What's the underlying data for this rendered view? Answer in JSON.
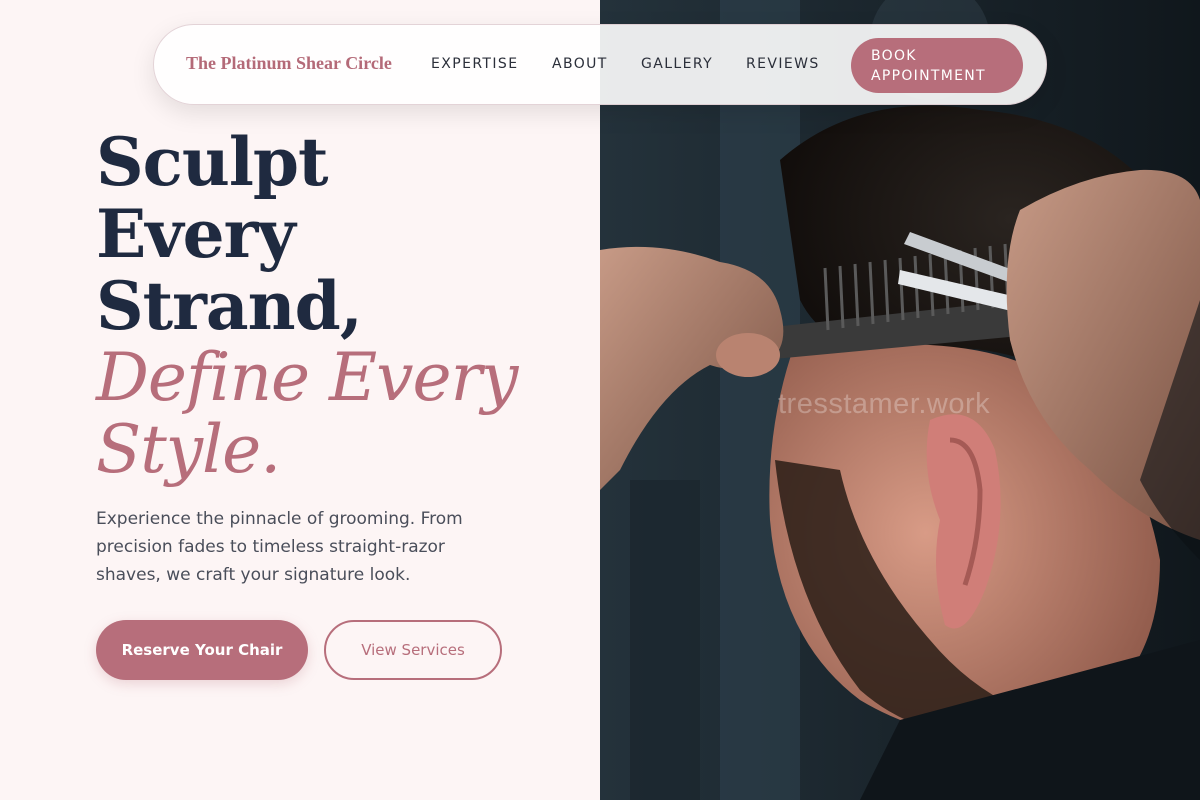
{
  "nav": {
    "brand": "The Platinum Shear Circle",
    "links": [
      "EXPERTISE",
      "ABOUT",
      "GALLERY",
      "REVIEWS"
    ],
    "cta": "BOOK APPOINTMENT"
  },
  "hero": {
    "headline_lines": [
      "Sculpt",
      "Every",
      "Strand,"
    ],
    "accent_lines": [
      "Define Every",
      "Style."
    ],
    "subtext": "Experience the pinnacle of grooming. From precision fades to timeless straight-razor shaves, we craft your signature look.",
    "primary_button": "Reserve Your Chair",
    "secondary_button": "View Services"
  },
  "photo": {
    "watermark": "tresstamer.work"
  },
  "colors": {
    "accent": "#b76e7b",
    "heading": "#1f2a40",
    "background": "#fdf5f5"
  }
}
